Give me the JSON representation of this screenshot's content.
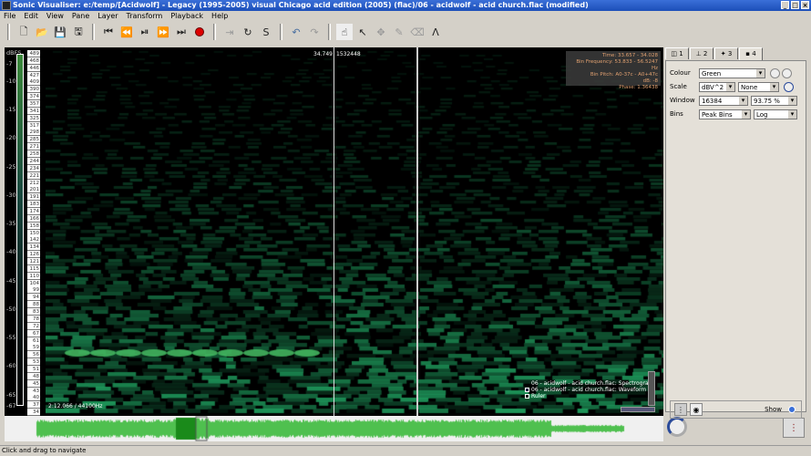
{
  "window": {
    "title": "Sonic Visualiser: e:/temp/[Acidwolf] - Legacy (1995-2005) visual Chicago acid edition (2005) (flac)/06 - acidwolf - acid church.flac (modified)"
  },
  "menu": [
    "File",
    "Edit",
    "View",
    "Pane",
    "Layer",
    "Transform",
    "Playback",
    "Help"
  ],
  "toolbar": {
    "icons": [
      "new-icon",
      "open-icon",
      "save-icon",
      "save-as-icon",
      "rewind-start-icon",
      "rewind-icon",
      "play-pause-icon",
      "fast-forward-icon",
      "forward-end-icon",
      "record-icon",
      "play-selection-icon",
      "loop-icon",
      "solo-icon",
      "undo-icon",
      "redo-icon",
      "navigate-icon",
      "select-icon",
      "move-icon",
      "draw-icon",
      "erase-icon",
      "measure-icon"
    ]
  },
  "pane": {
    "db_unit": "dBFS",
    "db_ticks": [
      "-7",
      "-10",
      "-15",
      "-20",
      "-25",
      "-30",
      "-35",
      "-40",
      "-45",
      "-50",
      "-55",
      "-60",
      "-65",
      "-67"
    ],
    "key_labels": [
      "489",
      "468",
      "446",
      "427",
      "409",
      "390",
      "374",
      "357",
      "341",
      "325",
      "317",
      "298",
      "285",
      "271",
      "258",
      "244",
      "234",
      "221",
      "212",
      "201",
      "191",
      "183",
      "174",
      "166",
      "158",
      "150",
      "142",
      "134",
      "126",
      "121",
      "115",
      "110",
      "104",
      "99",
      "94",
      "88",
      "83",
      "78",
      "72",
      "67",
      "61",
      "59",
      "56",
      "53",
      "51",
      "48",
      "45",
      "43",
      "40",
      "37",
      "34"
    ],
    "cursor_time": "34.749",
    "cursor_frame": "1532448",
    "readout": {
      "time": "Time: 33.657 - 34.028",
      "freq": "Bin Frequency: 53.833 - 56.5247 Hz",
      "pitch": "Bin Pitch: A0-37c - A0+47c",
      "db": "dB: -8",
      "phase": "Phase: 1.36438"
    },
    "bottom_time": "2:12.066 / 44100Hz",
    "layers": [
      "06 - acidwolf - acid church.flac: Spectrogram",
      "06 - acidwolf - acid church.flac: Waveform",
      "Ruler"
    ],
    "colors": {
      "spectrum": "#3cb86a",
      "waveform": "#4fc04f"
    }
  },
  "panel": {
    "tabs": [
      "1",
      "2",
      "3",
      "4"
    ],
    "colour_label": "Colour",
    "colour": "Green",
    "scale_label": "Scale",
    "scale": "dBV^2",
    "normalize": "None",
    "window_label": "Window",
    "window": "16384",
    "overlap": "93.75 %",
    "bins_label": "Bins",
    "bins": "Peak Bins",
    "freq_scale": "Log",
    "show_label": "Show"
  },
  "status": "Click and drag to navigate"
}
